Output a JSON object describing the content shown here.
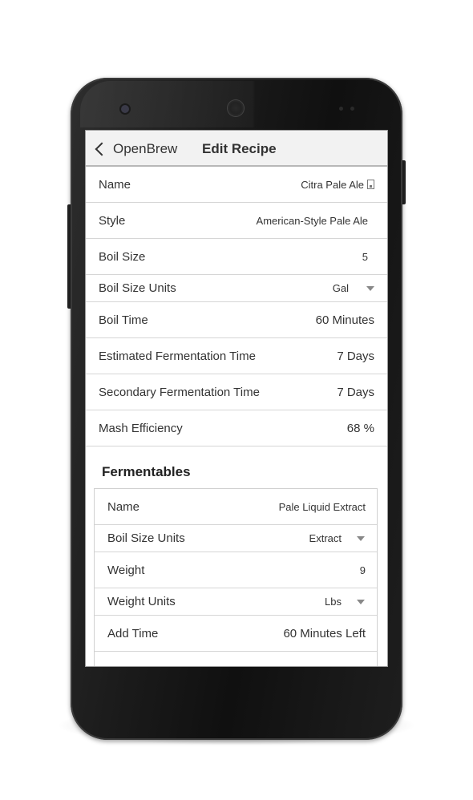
{
  "navbar": {
    "back_label": "OpenBrew",
    "title": "Edit Recipe"
  },
  "recipe": {
    "name_label": "Name",
    "name_value": "Citra Pale Ale",
    "style_label": "Style",
    "style_value": "American-Style Pale Ale",
    "boil_size_label": "Boil Size",
    "boil_size_value": "5",
    "boil_units_label": "Boil Size Units",
    "boil_units_value": "Gal",
    "boil_time_label": "Boil Time",
    "boil_time_value": "60 Minutes",
    "est_ferm_label": "Estimated Fermentation Time",
    "est_ferm_value": "7 Days",
    "sec_ferm_label": "Secondary Fermentation Time",
    "sec_ferm_value": "7 Days",
    "mash_label": "Mash Efficiency",
    "mash_value": "68 %"
  },
  "fermentables": {
    "header": "Fermentables",
    "name_label": "Name",
    "name_value": "Pale Liquid Extract",
    "type_label": "Boil Size Units",
    "type_value": "Extract",
    "weight_label": "Weight",
    "weight_value": "9",
    "weight_units_label": "Weight Units",
    "weight_units_value": "Lbs",
    "add_time_label": "Add Time",
    "add_time_value": "60 Minutes Left"
  },
  "icons": {
    "back": "chevron-left-icon",
    "contact": "contact-card-icon",
    "dropdown": "triangle-down-icon"
  }
}
